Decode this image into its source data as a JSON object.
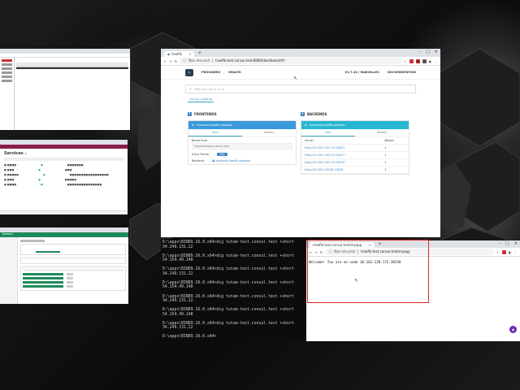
{
  "main_browser": {
    "tab_title": "traefik",
    "not_secure": "Non sécurisé",
    "url": "traefik-test.consul.test:8080/dashboard/#/",
    "nav": {
      "providers": "PROVIDERS",
      "health": "HEALTH",
      "version": "V1.7.24 / MAROILLES",
      "docs": "DOCUMENTATION"
    },
    "filter_placeholder": "Filter by name or id",
    "provider_tab": "consul_catalog",
    "frontends": {
      "title": "FRONTENDS",
      "num": "1",
      "card_title": "frontend-traefik-webapp",
      "tabs": [
        "Main",
        "Details"
      ],
      "route_rule_label": "Route Rule",
      "route_rule_value": "Host:webapp.consul.test",
      "entry_points_label": "Entry Points",
      "entry_point": "http",
      "backend_label": "Backend",
      "backend_value": "backend-traefik-webapp"
    },
    "backends": {
      "title": "BACKENDS",
      "num": "1",
      "card_title": "backend-traefik-webapp",
      "tabs": [
        "Main",
        "Details"
      ],
      "col_server": "Server",
      "col_weight": "Weight",
      "rows": [
        {
          "server": "http://10.162.128.172:30327",
          "weight": "1"
        },
        {
          "server": "http://10.162.128.171:24477",
          "weight": "1"
        },
        {
          "server": "http://10.162.128.172:30150",
          "weight": "1"
        },
        {
          "server": "http://10.162.128.69:25839",
          "weight": "1"
        }
      ]
    }
  },
  "terminal": {
    "lines": [
      "D:\\apps\\BIND9.16.0.x64>dig tutum-test.consul.test +short",
      "34.249.131.22",
      "",
      "D:\\apps\\BIND9.16.0.x64>dig tutum-test.consul.test +short",
      "54.154.49.148",
      "",
      "D:\\apps\\BIND9.16.0.x64>dig tutum-test.consul.test +short",
      "34.249.131.22",
      "",
      "D:\\apps\\BIND9.16.0.x64>dig tutum-test.consul.test +short",
      "54.154.49.148",
      "",
      "D:\\apps\\BIND9.16.0.x64>dig tutum-test.consul.test +short",
      "34.249.131.22",
      "",
      "D:\\apps\\BIND9.16.0.x64>dig tutum-test.consul.test +short",
      "54.154.49.148",
      "",
      "D:\\apps\\BIND9.16.0.x64>dig tutum-test.consul.test +short",
      "34.249.131.22",
      "",
      "D:\\apps\\BIND9.16.0.x64>"
    ]
  },
  "small_browser": {
    "tab_title": "traefik-test.consul.test/myapp",
    "not_secure": "Non sécurisé",
    "url": "traefik-test.consul.test/myapp",
    "body_text": "Welcome! You are on node 10.162.128.172:30150"
  },
  "consul_window": {
    "heading": "Services",
    "count": "6"
  },
  "nomad_window": {
    "title": "Nomad"
  },
  "colors": {
    "accent_blue": "#3a82c4",
    "frontend_header": "#3a9ad9",
    "backend_header": "#29b6d1",
    "consul_bar": "#8b1d4b",
    "nomad_bar": "#1e8a5a",
    "highlight_red": "#e02424"
  }
}
